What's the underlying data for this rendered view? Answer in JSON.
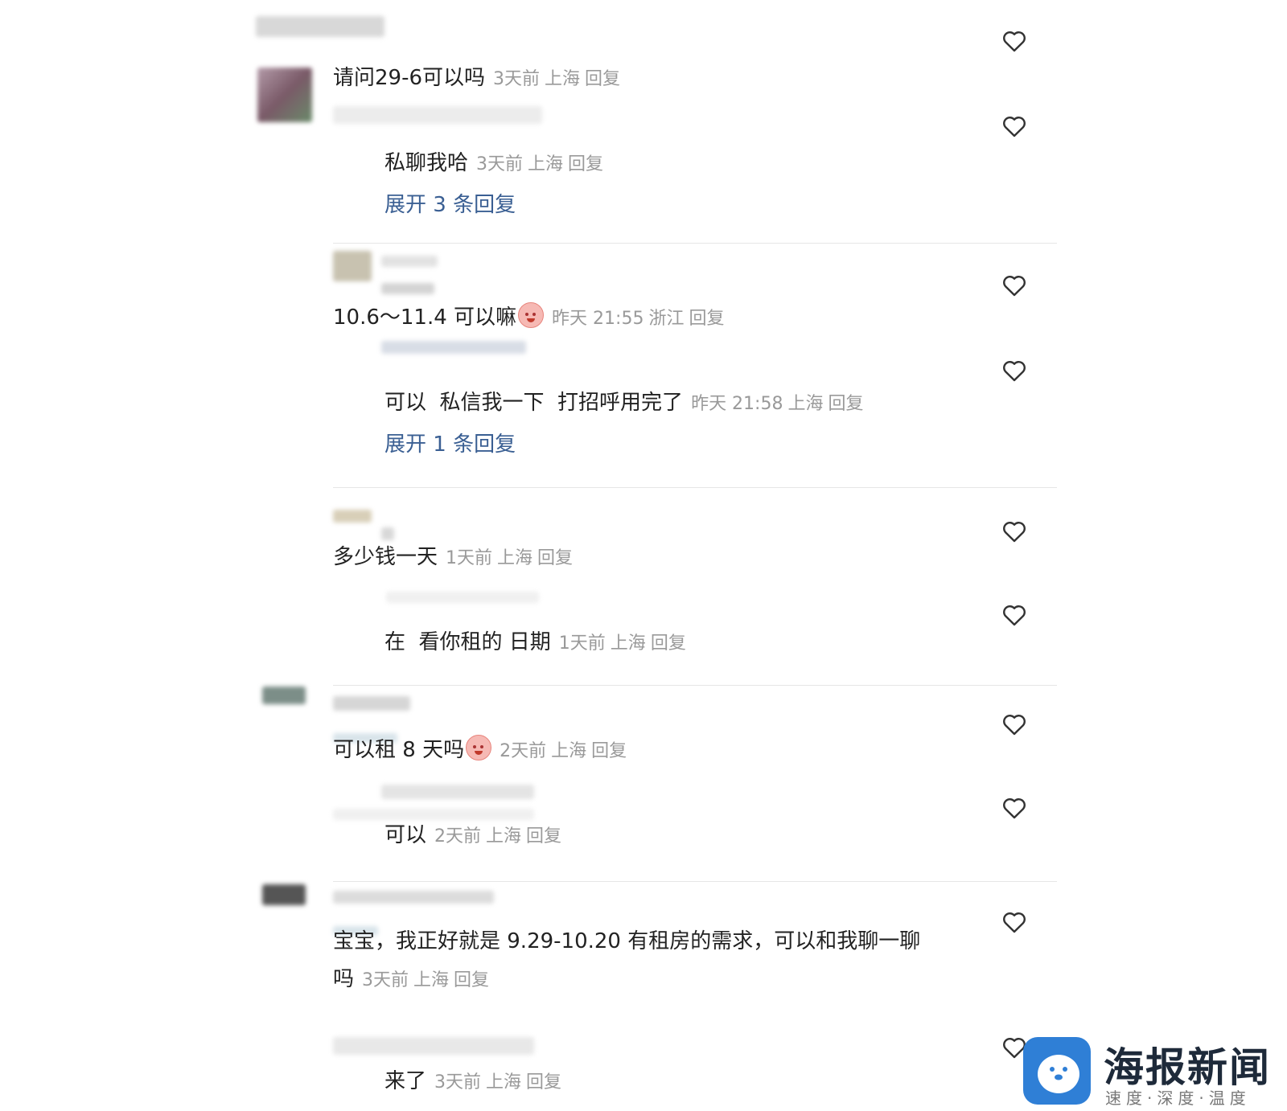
{
  "comments": [
    {
      "text": "请问29-6可以吗",
      "time": "3天前",
      "location": "上海",
      "reply": "回复"
    },
    {
      "text": "私聊我哈",
      "time": "3天前",
      "location": "上海",
      "reply": "回复"
    },
    {
      "expand": "展开 3 条回复"
    },
    {
      "text": "10.6～11.4 可以嘛",
      "time": "昨天 21:55",
      "location": "浙江",
      "reply": "回复"
    },
    {
      "text": "可以  私信我一下  打招呼用完了",
      "time": "昨天 21:58",
      "location": "上海",
      "reply": "回复"
    },
    {
      "expand": "展开 1 条回复"
    },
    {
      "text": "多少钱一天",
      "time": "1天前",
      "location": "上海",
      "reply": "回复"
    },
    {
      "text": "在  看你租的 日期",
      "time": "1天前",
      "location": "上海",
      "reply": "回复"
    },
    {
      "text": "可以租 8 天吗",
      "time": "2天前",
      "location": "上海",
      "reply": "回复"
    },
    {
      "text": "可以",
      "time": "2天前",
      "location": "上海",
      "reply": "回复"
    },
    {
      "text_line1": "宝宝，我正好就是 9.29-10.20 有租房的需求，可以和我聊一聊",
      "text_line2": "吗",
      "time": "3天前",
      "location": "上海",
      "reply": "回复"
    },
    {
      "text": "来了",
      "time": "3天前",
      "location": "上海",
      "reply": "回复"
    }
  ],
  "watermark": {
    "title": "海报新闻",
    "subtitle": "速度·深度·温度"
  },
  "icons": {
    "like": "heart-icon",
    "logo": "seal-logo-icon"
  }
}
